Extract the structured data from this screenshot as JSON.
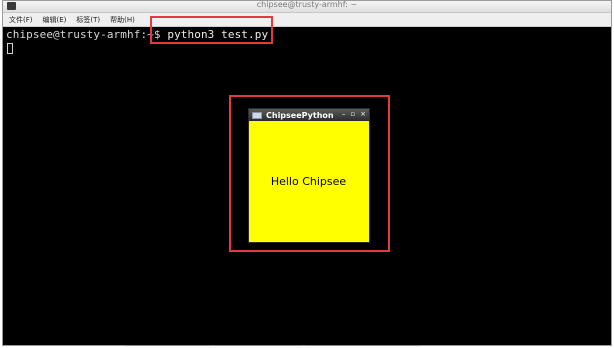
{
  "window": {
    "title": "chipsee@trusty-armhf: ~"
  },
  "menubar": {
    "items": [
      "文件(F)",
      "编辑(E)",
      "标签(T)",
      "帮助(H)"
    ]
  },
  "terminal": {
    "prompt": "chipsee@trusty-armhf:~$ ",
    "command": "python3 test.py"
  },
  "app_window": {
    "title": "ChipseePython",
    "minimize_glyph": "–",
    "maximize_glyph": "▫",
    "close_glyph": "×",
    "label": "Hello Chipsee",
    "background_color": "#ffff00"
  },
  "colors": {
    "terminal_bg": "#000000",
    "highlight": "#e23a3f"
  }
}
